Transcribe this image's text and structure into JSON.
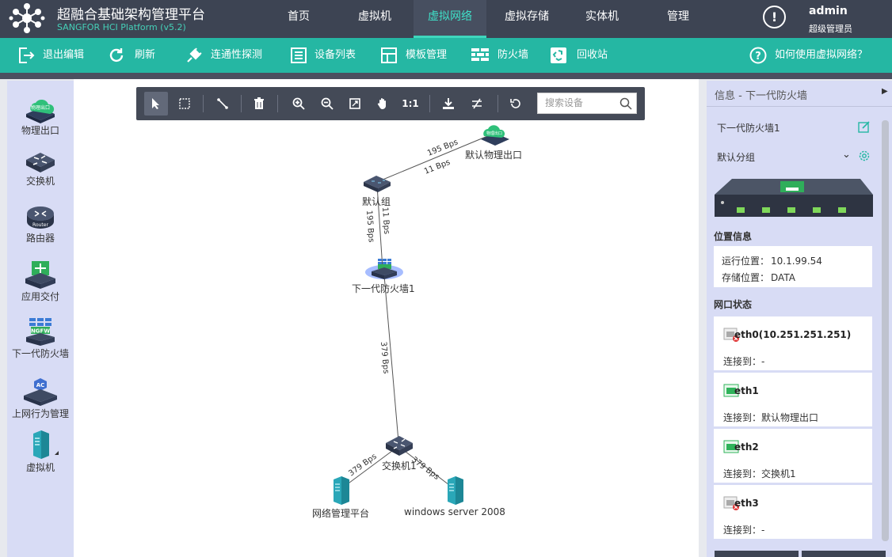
{
  "app": {
    "title": "超融合基础架构管理平台",
    "subtitle": "SANGFOR HCI Platform (v5.2)"
  },
  "nav": [
    "首页",
    "虚拟机",
    "虚拟网络",
    "虚拟存储",
    "实体机",
    "管理"
  ],
  "user": {
    "name": "admin",
    "role": "超级管理员"
  },
  "toolbar": {
    "exit_edit": "退出编辑",
    "refresh": "刷新",
    "connectivity": "连通性探测",
    "device_list": "设备列表",
    "template": "模板管理",
    "firewall": "防火墙",
    "recycle": "回收站",
    "help": "如何使用虚拟网络？"
  },
  "palette": [
    "物理出口",
    "交换机",
    "路由器",
    "应用交付",
    "下一代防火墙",
    "上网行为管理",
    "虚拟机"
  ],
  "canvas": {
    "zoom_reset_label": "1:1",
    "search_placeholder": "搜索设备"
  },
  "topology": {
    "nodes": {
      "physical_exit": "默认物理出口",
      "default_group": "默认组",
      "ngfw": "下一代防火墙1",
      "switch": "交换机1",
      "vm1": "网络管理平台",
      "vm2": "windows server 2008"
    },
    "icon_text": {
      "cloud": "物理出口",
      "ngfw": "NGFW",
      "router": "Router",
      "ac": "AC"
    },
    "links": {
      "exit_group_a": "195 Bps",
      "exit_group_b": "11 Bps",
      "group_ngfw_a": "195 Bps",
      "group_ngfw_b": "11 Bps",
      "ngfw_switch": "379 Bps",
      "switch_vm1": "379 Bps",
      "switch_vm2": "379 Bps"
    }
  },
  "info_panel": {
    "title": "信息 - 下一代防火墙",
    "device_name": "下一代防火墙1",
    "group": "默认分组",
    "location_title": "位置信息",
    "run_location_label": "运行位置：",
    "run_location": "10.1.99.54",
    "storage_label": "存储位置：",
    "storage": "DATA",
    "port_status_title": "网口状态",
    "ports": [
      {
        "name": "eth0(10.251.251.251)",
        "connected_to": "连接到：-",
        "status": "down"
      },
      {
        "name": "eth1",
        "connected_to": "连接到：默认物理出口",
        "status": "up"
      },
      {
        "name": "eth2",
        "connected_to": "连接到：交换机1",
        "status": "up"
      },
      {
        "name": "eth3",
        "connected_to": "连接到：-",
        "status": "down"
      }
    ]
  },
  "colors": {
    "accent": "#25b7a3",
    "topbar": "#3d4453",
    "panel": "#d8dcf5",
    "up": "#2fb35a",
    "down": "#e03030"
  }
}
